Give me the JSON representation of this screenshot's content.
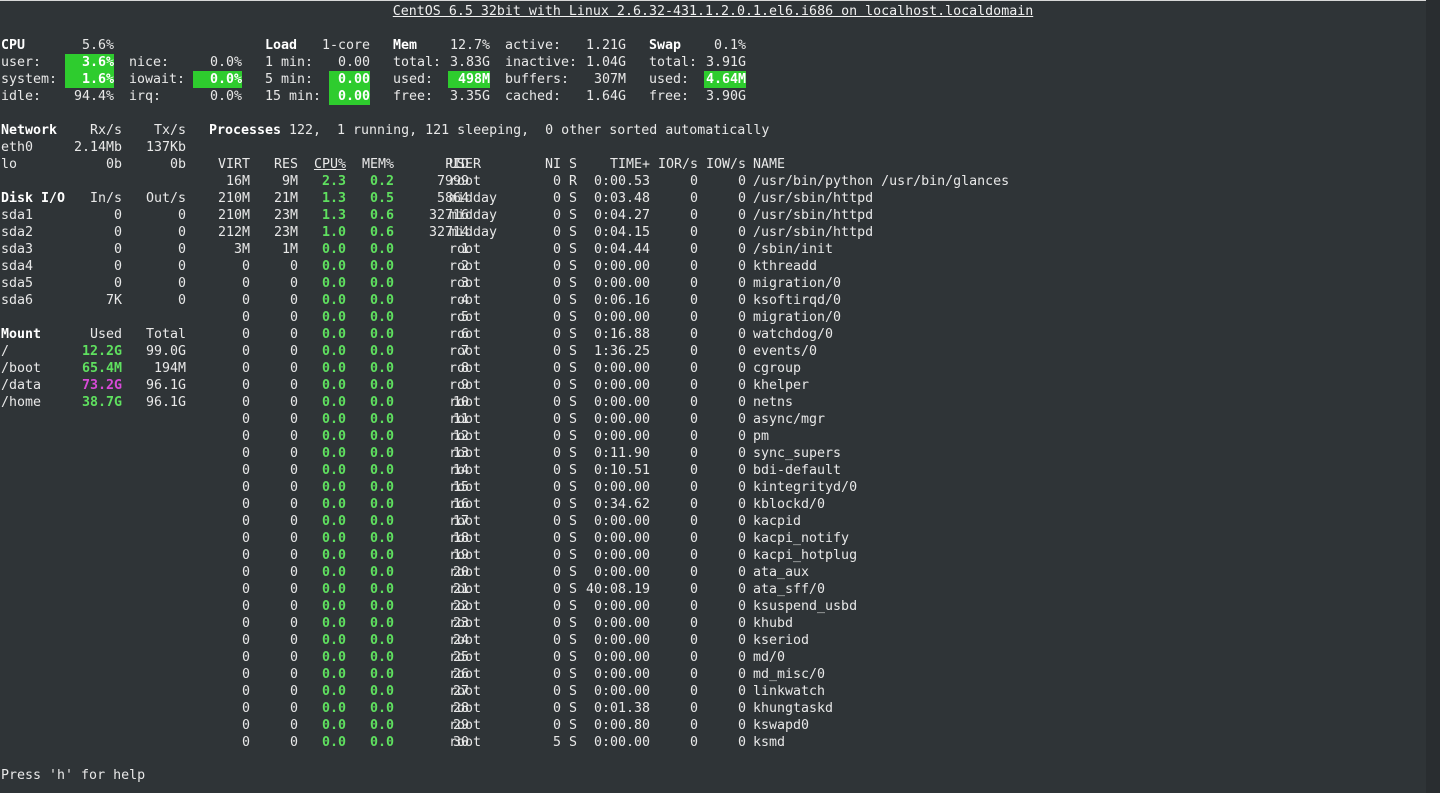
{
  "title": "CentOS 6.5 32bit with Linux 2.6.32-431.1.2.0.1.el6.i686 on localhost.localdomain",
  "cpu": {
    "label": "CPU",
    "total": "5.6%",
    "user_label": "user:",
    "user": "3.6%",
    "system_label": "system:",
    "system": "1.6%",
    "idle_label": "idle:",
    "idle": "94.4%",
    "nice_label": "nice:",
    "nice": "0.0%",
    "iowait_label": "iowait:",
    "iowait": "0.0%",
    "irq_label": "irq:",
    "irq": "0.0%"
  },
  "load": {
    "label": "Load",
    "cores": "1-core",
    "m1_label": "1 min:",
    "m1": "0.00",
    "m5_label": "5 min:",
    "m5": "0.00",
    "m15_label": "15 min:",
    "m15": "0.00"
  },
  "mem": {
    "label": "Mem",
    "percent": "12.7%",
    "total_label": "total:",
    "total": "3.83G",
    "used_label": "used:",
    "used": "498M",
    "free_label": "free:",
    "free": "3.35G",
    "active_label": "active:",
    "active": "1.21G",
    "inactive_label": "inactive:",
    "inactive": "1.04G",
    "buffers_label": "buffers:",
    "buffers": "307M",
    "cached_label": "cached:",
    "cached": "1.64G"
  },
  "swap": {
    "label": "Swap",
    "percent": "0.1%",
    "total_label": "total:",
    "total": "3.91G",
    "used_label": "used:",
    "used": "4.64M",
    "free_label": "free:",
    "free": "3.90G"
  },
  "network": {
    "headers": [
      "Network",
      "Rx/s",
      "Tx/s"
    ],
    "rows": [
      [
        "eth0",
        "2.14Mb",
        "137Kb"
      ],
      [
        "lo",
        "0b",
        "0b"
      ]
    ]
  },
  "disk": {
    "headers": [
      "Disk I/O",
      "In/s",
      "Out/s"
    ],
    "rows": [
      [
        "sda1",
        "0",
        "0"
      ],
      [
        "sda2",
        "0",
        "0"
      ],
      [
        "sda3",
        "0",
        "0"
      ],
      [
        "sda4",
        "0",
        "0"
      ],
      [
        "sda5",
        "0",
        "0"
      ],
      [
        "sda6",
        "7K",
        "0"
      ]
    ]
  },
  "mount": {
    "headers": [
      "Mount",
      "Used",
      "Total"
    ],
    "rows": [
      [
        "/",
        "12.2G",
        "99.0G",
        "green"
      ],
      [
        "/boot",
        "65.4M",
        "194M",
        "green"
      ],
      [
        "/data",
        "73.2G",
        "96.1G",
        "magenta"
      ],
      [
        "/home",
        "38.7G",
        "96.1G",
        "green"
      ]
    ]
  },
  "processes": {
    "label": "Processes",
    "summary": "122,  1 running, 121 sleeping,  0 other sorted automatically",
    "headers": [
      "VIRT",
      "RES",
      "CPU%",
      "MEM%",
      "PID",
      "USER",
      "NI",
      "S",
      "TIME+",
      "IOR/s",
      "IOW/s",
      "NAME"
    ],
    "rows": [
      [
        "16M",
        "9M",
        "2.3",
        "0.2",
        "7999",
        "root",
        "0",
        "R",
        "0:00.53",
        "0",
        "0",
        "/usr/bin/python /usr/bin/glances"
      ],
      [
        "210M",
        "21M",
        "1.3",
        "0.5",
        "5864",
        "midday",
        "0",
        "S",
        "0:03.48",
        "0",
        "0",
        "/usr/sbin/httpd"
      ],
      [
        "210M",
        "23M",
        "1.3",
        "0.6",
        "32716",
        "midday",
        "0",
        "S",
        "0:04.27",
        "0",
        "0",
        "/usr/sbin/httpd"
      ],
      [
        "212M",
        "23M",
        "1.0",
        "0.6",
        "32714",
        "midday",
        "0",
        "S",
        "0:04.15",
        "0",
        "0",
        "/usr/sbin/httpd"
      ],
      [
        "3M",
        "1M",
        "0.0",
        "0.0",
        "1",
        "root",
        "0",
        "S",
        "0:04.44",
        "0",
        "0",
        "/sbin/init"
      ],
      [
        "0",
        "0",
        "0.0",
        "0.0",
        "2",
        "root",
        "0",
        "S",
        "0:00.00",
        "0",
        "0",
        "kthreadd"
      ],
      [
        "0",
        "0",
        "0.0",
        "0.0",
        "3",
        "root",
        "0",
        "S",
        "0:00.00",
        "0",
        "0",
        "migration/0"
      ],
      [
        "0",
        "0",
        "0.0",
        "0.0",
        "4",
        "root",
        "0",
        "S",
        "0:06.16",
        "0",
        "0",
        "ksoftirqd/0"
      ],
      [
        "0",
        "0",
        "0.0",
        "0.0",
        "5",
        "root",
        "0",
        "S",
        "0:00.00",
        "0",
        "0",
        "migration/0"
      ],
      [
        "0",
        "0",
        "0.0",
        "0.0",
        "6",
        "root",
        "0",
        "S",
        "0:16.88",
        "0",
        "0",
        "watchdog/0"
      ],
      [
        "0",
        "0",
        "0.0",
        "0.0",
        "7",
        "root",
        "0",
        "S",
        "1:36.25",
        "0",
        "0",
        "events/0"
      ],
      [
        "0",
        "0",
        "0.0",
        "0.0",
        "8",
        "root",
        "0",
        "S",
        "0:00.00",
        "0",
        "0",
        "cgroup"
      ],
      [
        "0",
        "0",
        "0.0",
        "0.0",
        "9",
        "root",
        "0",
        "S",
        "0:00.00",
        "0",
        "0",
        "khelper"
      ],
      [
        "0",
        "0",
        "0.0",
        "0.0",
        "10",
        "root",
        "0",
        "S",
        "0:00.00",
        "0",
        "0",
        "netns"
      ],
      [
        "0",
        "0",
        "0.0",
        "0.0",
        "11",
        "root",
        "0",
        "S",
        "0:00.00",
        "0",
        "0",
        "async/mgr"
      ],
      [
        "0",
        "0",
        "0.0",
        "0.0",
        "12",
        "root",
        "0",
        "S",
        "0:00.00",
        "0",
        "0",
        "pm"
      ],
      [
        "0",
        "0",
        "0.0",
        "0.0",
        "13",
        "root",
        "0",
        "S",
        "0:11.90",
        "0",
        "0",
        "sync_supers"
      ],
      [
        "0",
        "0",
        "0.0",
        "0.0",
        "14",
        "root",
        "0",
        "S",
        "0:10.51",
        "0",
        "0",
        "bdi-default"
      ],
      [
        "0",
        "0",
        "0.0",
        "0.0",
        "15",
        "root",
        "0",
        "S",
        "0:00.00",
        "0",
        "0",
        "kintegrityd/0"
      ],
      [
        "0",
        "0",
        "0.0",
        "0.0",
        "16",
        "root",
        "0",
        "S",
        "0:34.62",
        "0",
        "0",
        "kblockd/0"
      ],
      [
        "0",
        "0",
        "0.0",
        "0.0",
        "17",
        "root",
        "0",
        "S",
        "0:00.00",
        "0",
        "0",
        "kacpid"
      ],
      [
        "0",
        "0",
        "0.0",
        "0.0",
        "18",
        "root",
        "0",
        "S",
        "0:00.00",
        "0",
        "0",
        "kacpi_notify"
      ],
      [
        "0",
        "0",
        "0.0",
        "0.0",
        "19",
        "root",
        "0",
        "S",
        "0:00.00",
        "0",
        "0",
        "kacpi_hotplug"
      ],
      [
        "0",
        "0",
        "0.0",
        "0.0",
        "20",
        "root",
        "0",
        "S",
        "0:00.00",
        "0",
        "0",
        "ata_aux"
      ],
      [
        "0",
        "0",
        "0.0",
        "0.0",
        "21",
        "root",
        "0",
        "S",
        "40:08.19",
        "0",
        "0",
        "ata_sff/0"
      ],
      [
        "0",
        "0",
        "0.0",
        "0.0",
        "22",
        "root",
        "0",
        "S",
        "0:00.00",
        "0",
        "0",
        "ksuspend_usbd"
      ],
      [
        "0",
        "0",
        "0.0",
        "0.0",
        "23",
        "root",
        "0",
        "S",
        "0:00.00",
        "0",
        "0",
        "khubd"
      ],
      [
        "0",
        "0",
        "0.0",
        "0.0",
        "24",
        "root",
        "0",
        "S",
        "0:00.00",
        "0",
        "0",
        "kseriod"
      ],
      [
        "0",
        "0",
        "0.0",
        "0.0",
        "25",
        "root",
        "0",
        "S",
        "0:00.00",
        "0",
        "0",
        "md/0"
      ],
      [
        "0",
        "0",
        "0.0",
        "0.0",
        "26",
        "root",
        "0",
        "S",
        "0:00.00",
        "0",
        "0",
        "md_misc/0"
      ],
      [
        "0",
        "0",
        "0.0",
        "0.0",
        "27",
        "root",
        "0",
        "S",
        "0:00.00",
        "0",
        "0",
        "linkwatch"
      ],
      [
        "0",
        "0",
        "0.0",
        "0.0",
        "28",
        "root",
        "0",
        "S",
        "0:01.38",
        "0",
        "0",
        "khungtaskd"
      ],
      [
        "0",
        "0",
        "0.0",
        "0.0",
        "29",
        "root",
        "0",
        "S",
        "0:00.80",
        "0",
        "0",
        "kswapd0"
      ],
      [
        "0",
        "0",
        "0.0",
        "0.0",
        "30",
        "root",
        "5",
        "S",
        "0:00.00",
        "0",
        "0",
        "ksmd"
      ]
    ]
  },
  "footer": {
    "help": "Press 'h' for help"
  }
}
